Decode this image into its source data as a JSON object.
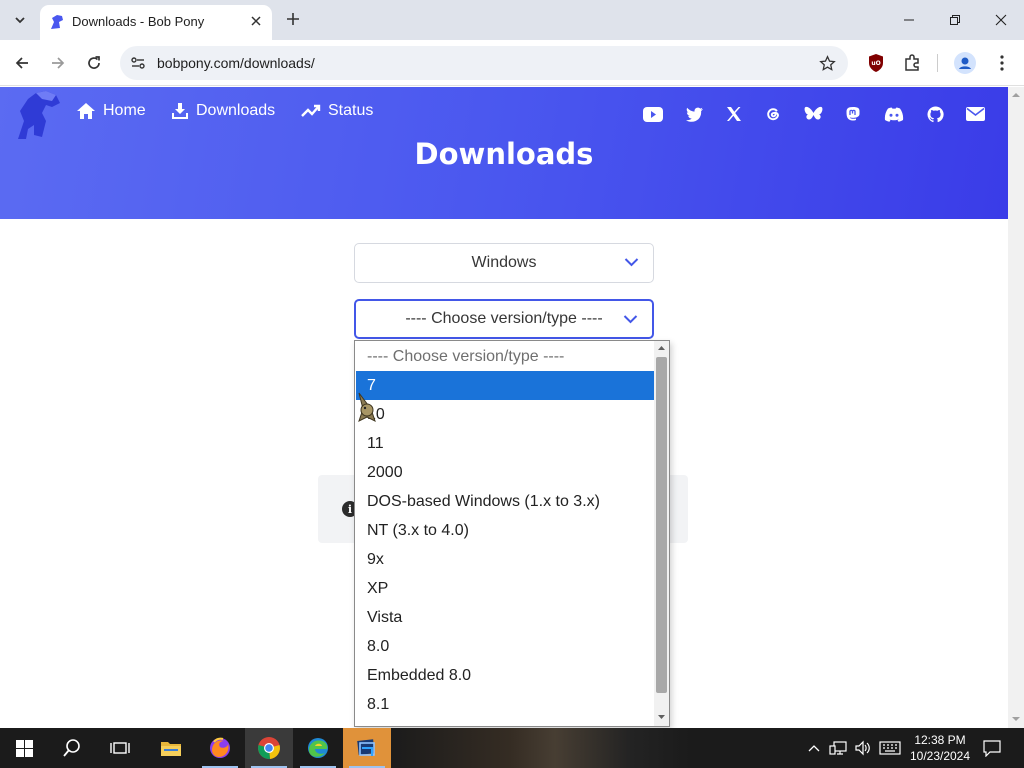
{
  "browser": {
    "tab_title": "Downloads - Bob Pony",
    "url": "bobpony.com/downloads/"
  },
  "site": {
    "nav": [
      {
        "label": "Home",
        "icon": "home-icon"
      },
      {
        "label": "Downloads",
        "icon": "download-icon"
      },
      {
        "label": "Status",
        "icon": "trending-up-icon"
      }
    ],
    "socials": [
      "youtube-icon",
      "twitter-icon",
      "x-icon",
      "threads-icon",
      "bluesky-icon",
      "mastodon-icon",
      "discord-icon",
      "github-icon",
      "email-icon"
    ],
    "hero_title": "Downloads",
    "brand_color": "#4a57ef"
  },
  "form": {
    "os_select_value": "Windows",
    "version_select_value": "---- Choose version/type ----"
  },
  "dropdown": {
    "options": [
      "---- Choose version/type ----",
      "7",
      "10",
      "11",
      "2000",
      "DOS-based Windows (1.x to 3.x)",
      "NT (3.x to 4.0)",
      "9x",
      "XP",
      "Vista",
      "8.0",
      "Embedded 8.0",
      "8.1"
    ],
    "highlighted_index": 1,
    "highlight_color": "#1a73d9"
  },
  "taskbar": {
    "time": "12:38 PM",
    "date": "10/23/2024",
    "apps": [
      "file-explorer-icon",
      "firefox-icon",
      "chrome-icon",
      "edge-beta-icon",
      "virtualbox-icon"
    ]
  }
}
